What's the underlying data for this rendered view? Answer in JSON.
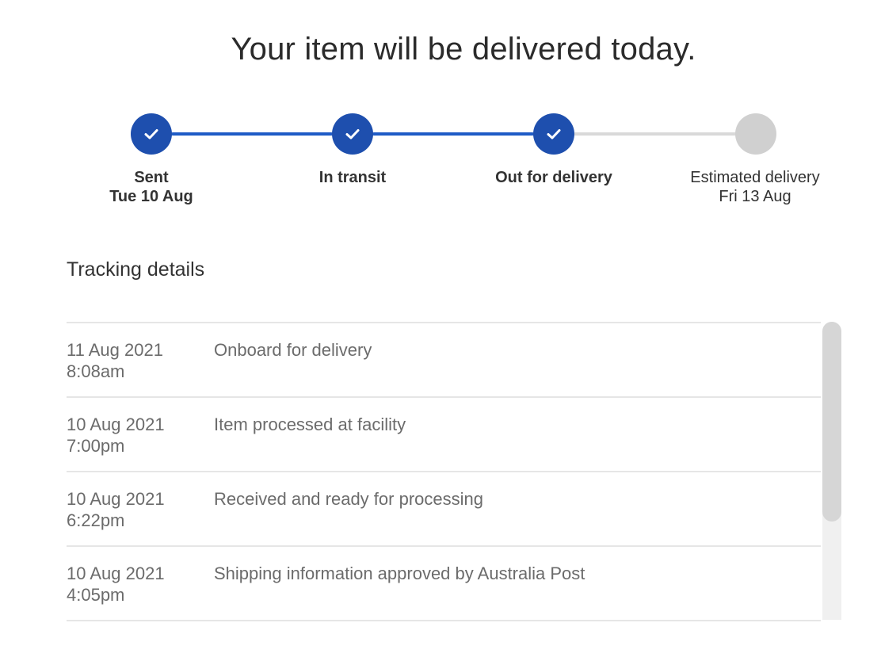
{
  "headline": "Your item will be delivered today.",
  "progress": {
    "steps": [
      {
        "label": "Sent",
        "date": "Tue 10 Aug",
        "complete": true,
        "bold": true
      },
      {
        "label": "In transit",
        "date": "",
        "complete": true,
        "bold": true
      },
      {
        "label": "Out for delivery",
        "date": "",
        "complete": true,
        "bold": true
      },
      {
        "label": "Estimated delivery",
        "date": "Fri 13 Aug",
        "complete": false,
        "bold": false
      }
    ],
    "complete_color": "#1e4fae",
    "pending_color": "#d0d0d0",
    "icon": "checkmark-icon"
  },
  "tracking": {
    "title": "Tracking details",
    "events": [
      {
        "date": "11 Aug 2021",
        "time": "8:08am",
        "description": "Onboard for delivery"
      },
      {
        "date": "10 Aug 2021",
        "time": "7:00pm",
        "description": "Item processed at facility"
      },
      {
        "date": "10 Aug 2021",
        "time": "6:22pm",
        "description": "Received and ready for processing"
      },
      {
        "date": "10 Aug 2021",
        "time": "4:05pm",
        "description": "Shipping information approved by Australia Post"
      }
    ]
  }
}
